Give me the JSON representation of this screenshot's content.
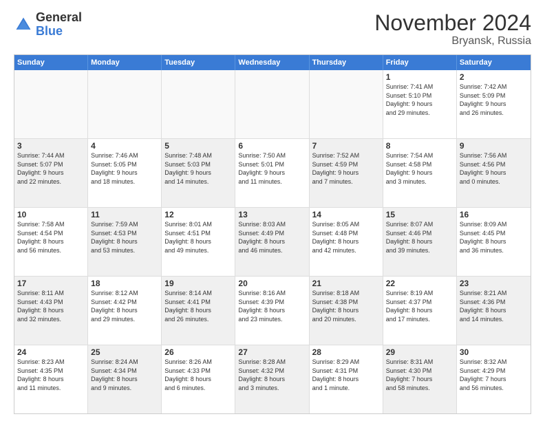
{
  "logo": {
    "general": "General",
    "blue": "Blue"
  },
  "title": "November 2024",
  "location": "Bryansk, Russia",
  "days_of_week": [
    "Sunday",
    "Monday",
    "Tuesday",
    "Wednesday",
    "Thursday",
    "Friday",
    "Saturday"
  ],
  "weeks": [
    [
      {
        "day": "",
        "info": "",
        "empty": true
      },
      {
        "day": "",
        "info": "",
        "empty": true
      },
      {
        "day": "",
        "info": "",
        "empty": true
      },
      {
        "day": "",
        "info": "",
        "empty": true
      },
      {
        "day": "",
        "info": "",
        "empty": true
      },
      {
        "day": "1",
        "info": "Sunrise: 7:41 AM\nSunset: 5:10 PM\nDaylight: 9 hours\nand 29 minutes."
      },
      {
        "day": "2",
        "info": "Sunrise: 7:42 AM\nSunset: 5:09 PM\nDaylight: 9 hours\nand 26 minutes."
      }
    ],
    [
      {
        "day": "3",
        "info": "Sunrise: 7:44 AM\nSunset: 5:07 PM\nDaylight: 9 hours\nand 22 minutes.",
        "shaded": true
      },
      {
        "day": "4",
        "info": "Sunrise: 7:46 AM\nSunset: 5:05 PM\nDaylight: 9 hours\nand 18 minutes."
      },
      {
        "day": "5",
        "info": "Sunrise: 7:48 AM\nSunset: 5:03 PM\nDaylight: 9 hours\nand 14 minutes.",
        "shaded": true
      },
      {
        "day": "6",
        "info": "Sunrise: 7:50 AM\nSunset: 5:01 PM\nDaylight: 9 hours\nand 11 minutes."
      },
      {
        "day": "7",
        "info": "Sunrise: 7:52 AM\nSunset: 4:59 PM\nDaylight: 9 hours\nand 7 minutes.",
        "shaded": true
      },
      {
        "day": "8",
        "info": "Sunrise: 7:54 AM\nSunset: 4:58 PM\nDaylight: 9 hours\nand 3 minutes."
      },
      {
        "day": "9",
        "info": "Sunrise: 7:56 AM\nSunset: 4:56 PM\nDaylight: 9 hours\nand 0 minutes.",
        "shaded": true
      }
    ],
    [
      {
        "day": "10",
        "info": "Sunrise: 7:58 AM\nSunset: 4:54 PM\nDaylight: 8 hours\nand 56 minutes."
      },
      {
        "day": "11",
        "info": "Sunrise: 7:59 AM\nSunset: 4:53 PM\nDaylight: 8 hours\nand 53 minutes.",
        "shaded": true
      },
      {
        "day": "12",
        "info": "Sunrise: 8:01 AM\nSunset: 4:51 PM\nDaylight: 8 hours\nand 49 minutes."
      },
      {
        "day": "13",
        "info": "Sunrise: 8:03 AM\nSunset: 4:49 PM\nDaylight: 8 hours\nand 46 minutes.",
        "shaded": true
      },
      {
        "day": "14",
        "info": "Sunrise: 8:05 AM\nSunset: 4:48 PM\nDaylight: 8 hours\nand 42 minutes."
      },
      {
        "day": "15",
        "info": "Sunrise: 8:07 AM\nSunset: 4:46 PM\nDaylight: 8 hours\nand 39 minutes.",
        "shaded": true
      },
      {
        "day": "16",
        "info": "Sunrise: 8:09 AM\nSunset: 4:45 PM\nDaylight: 8 hours\nand 36 minutes."
      }
    ],
    [
      {
        "day": "17",
        "info": "Sunrise: 8:11 AM\nSunset: 4:43 PM\nDaylight: 8 hours\nand 32 minutes.",
        "shaded": true
      },
      {
        "day": "18",
        "info": "Sunrise: 8:12 AM\nSunset: 4:42 PM\nDaylight: 8 hours\nand 29 minutes."
      },
      {
        "day": "19",
        "info": "Sunrise: 8:14 AM\nSunset: 4:41 PM\nDaylight: 8 hours\nand 26 minutes.",
        "shaded": true
      },
      {
        "day": "20",
        "info": "Sunrise: 8:16 AM\nSunset: 4:39 PM\nDaylight: 8 hours\nand 23 minutes."
      },
      {
        "day": "21",
        "info": "Sunrise: 8:18 AM\nSunset: 4:38 PM\nDaylight: 8 hours\nand 20 minutes.",
        "shaded": true
      },
      {
        "day": "22",
        "info": "Sunrise: 8:19 AM\nSunset: 4:37 PM\nDaylight: 8 hours\nand 17 minutes."
      },
      {
        "day": "23",
        "info": "Sunrise: 8:21 AM\nSunset: 4:36 PM\nDaylight: 8 hours\nand 14 minutes.",
        "shaded": true
      }
    ],
    [
      {
        "day": "24",
        "info": "Sunrise: 8:23 AM\nSunset: 4:35 PM\nDaylight: 8 hours\nand 11 minutes."
      },
      {
        "day": "25",
        "info": "Sunrise: 8:24 AM\nSunset: 4:34 PM\nDaylight: 8 hours\nand 9 minutes.",
        "shaded": true
      },
      {
        "day": "26",
        "info": "Sunrise: 8:26 AM\nSunset: 4:33 PM\nDaylight: 8 hours\nand 6 minutes."
      },
      {
        "day": "27",
        "info": "Sunrise: 8:28 AM\nSunset: 4:32 PM\nDaylight: 8 hours\nand 3 minutes.",
        "shaded": true
      },
      {
        "day": "28",
        "info": "Sunrise: 8:29 AM\nSunset: 4:31 PM\nDaylight: 8 hours\nand 1 minute."
      },
      {
        "day": "29",
        "info": "Sunrise: 8:31 AM\nSunset: 4:30 PM\nDaylight: 7 hours\nand 58 minutes.",
        "shaded": true
      },
      {
        "day": "30",
        "info": "Sunrise: 8:32 AM\nSunset: 4:29 PM\nDaylight: 7 hours\nand 56 minutes."
      }
    ]
  ]
}
